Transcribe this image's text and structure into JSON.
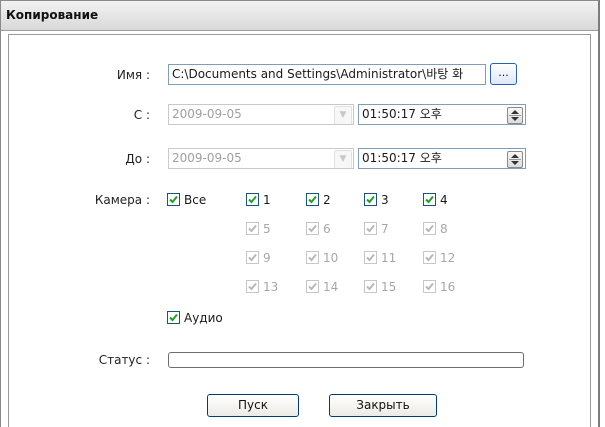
{
  "window": {
    "title": "Копирование"
  },
  "form": {
    "name_label": "Имя :",
    "name_value": "C:\\Documents and Settings\\Administrator\\바탕 화",
    "browse_label": "...",
    "from_label": "С :",
    "from_date": "2009-09-05",
    "from_time": "01:50:17 오후",
    "to_label": "До :",
    "to_date": "2009-09-05",
    "to_time": "01:50:17 오후",
    "camera_label": "Камера :",
    "all_label": "Все",
    "cameras": [
      {
        "label": "1",
        "checked": true,
        "enabled": true
      },
      {
        "label": "2",
        "checked": true,
        "enabled": true
      },
      {
        "label": "3",
        "checked": true,
        "enabled": true
      },
      {
        "label": "4",
        "checked": true,
        "enabled": true
      },
      {
        "label": "5",
        "checked": true,
        "enabled": false
      },
      {
        "label": "6",
        "checked": true,
        "enabled": false
      },
      {
        "label": "7",
        "checked": true,
        "enabled": false
      },
      {
        "label": "8",
        "checked": true,
        "enabled": false
      },
      {
        "label": "9",
        "checked": true,
        "enabled": false
      },
      {
        "label": "10",
        "checked": true,
        "enabled": false
      },
      {
        "label": "11",
        "checked": true,
        "enabled": false
      },
      {
        "label": "12",
        "checked": true,
        "enabled": false
      },
      {
        "label": "13",
        "checked": true,
        "enabled": false
      },
      {
        "label": "14",
        "checked": true,
        "enabled": false
      },
      {
        "label": "15",
        "checked": true,
        "enabled": false
      },
      {
        "label": "16",
        "checked": true,
        "enabled": false
      }
    ],
    "audio_label": "Аудио",
    "status_label": "Статус :",
    "status_progress": 0
  },
  "buttons": {
    "start": "Пуск",
    "close": "Закрыть"
  },
  "colors": {
    "check_enabled": "#21a121",
    "check_disabled": "#b8b8b8",
    "accent_border": "#2a5fb3"
  }
}
